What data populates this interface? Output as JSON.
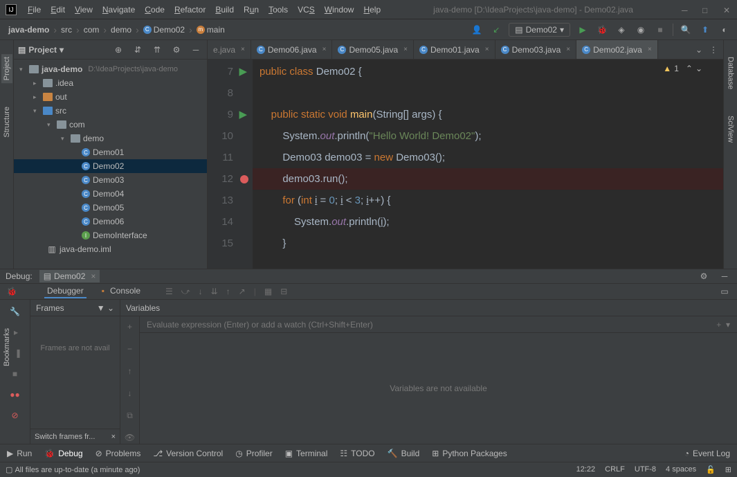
{
  "title": "java-demo [D:\\IdeaProjects\\java-demo] - Demo02.java",
  "menu": [
    "File",
    "Edit",
    "View",
    "Navigate",
    "Code",
    "Refactor",
    "Build",
    "Run",
    "Tools",
    "VCS",
    "Window",
    "Help"
  ],
  "breadcrumb": {
    "project": "java-demo",
    "parts": [
      "src",
      "com",
      "demo",
      "Demo02",
      "main"
    ]
  },
  "runConfig": "Demo02",
  "sideTabs": {
    "left": [
      "Project",
      "Structure",
      "Bookmarks"
    ],
    "right": [
      "Database",
      "SciView"
    ]
  },
  "projectPanel": {
    "title": "Project",
    "root": {
      "name": "java-demo",
      "path": "D:\\IdeaProjects\\java-demo"
    },
    "folders": {
      "idea": ".idea",
      "out": "out",
      "src": "src",
      "com": "com",
      "demo": "demo"
    },
    "classes": [
      "Demo01",
      "Demo02",
      "Demo03",
      "Demo04",
      "Demo05",
      "Demo06",
      "DemoInterface"
    ],
    "iml": "java-demo.iml"
  },
  "tabs": {
    "cut": "e.java",
    "items": [
      "Demo06.java",
      "Demo05.java",
      "Demo01.java",
      "Demo03.java",
      "Demo02.java"
    ],
    "active": "Demo02.java"
  },
  "code": {
    "lines": [
      {
        "n": 7,
        "run": true,
        "html": "<span class='kw'>public</span> <span class='kw'>class</span> <span class='txt'>Demo02 {</span>"
      },
      {
        "n": 8,
        "html": ""
      },
      {
        "n": 9,
        "run": true,
        "html": "    <span class='kw'>public</span> <span class='kw'>static</span> <span class='kw'>void</span> <span class='fn'>main</span><span class='txt'>(String[] args) {</span>"
      },
      {
        "n": 10,
        "html": "        <span class='txt'>System.</span><span class='fld'>out</span><span class='txt'>.println(</span><span class='str'>\"Hello World! Demo02\"</span><span class='txt'>);</span>"
      },
      {
        "n": 11,
        "html": "        <span class='txt'>Demo03 demo03 = </span><span class='kw'>new</span> <span class='txt'>Demo03();</span>"
      },
      {
        "n": 12,
        "bp": true,
        "html": "        <span class='txt'>demo03.run();</span>"
      },
      {
        "n": 13,
        "html": "        <span class='kw'>for</span> <span class='txt'>(</span><span class='kw'>int</span> <span class='txt'><u>i</u> = </span><span class='num'>0</span><span class='txt'>; <u>i</u> &lt; </span><span class='num'>3</span><span class='txt'>; <u>i</u>++) {</span>"
      },
      {
        "n": 14,
        "html": "            <span class='txt'>System.</span><span class='fld'>out</span><span class='txt'>.println(<u>i</u>);</span>"
      },
      {
        "n": 15,
        "html": "        <span class='txt'>}</span>"
      }
    ],
    "warnCount": "1"
  },
  "debug": {
    "label": "Debug:",
    "config": "Demo02",
    "subtabs": {
      "debugger": "Debugger",
      "console": "Console"
    },
    "frames": {
      "title": "Frames",
      "empty": "Frames are not avail",
      "footer": "Switch frames fr..."
    },
    "vars": {
      "title": "Variables",
      "placeholder": "Evaluate expression (Enter) or add a watch (Ctrl+Shift+Enter)",
      "empty": "Variables are not available"
    }
  },
  "bottomBar": {
    "run": "Run",
    "debug": "Debug",
    "problems": "Problems",
    "vcs": "Version Control",
    "profiler": "Profiler",
    "terminal": "Terminal",
    "todo": "TODO",
    "build": "Build",
    "python": "Python Packages",
    "eventlog": "Event Log"
  },
  "statusBar": {
    "msg": "All files are up-to-date (a minute ago)",
    "time": "12:22",
    "eol": "CRLF",
    "enc": "UTF-8",
    "indent": "4 spaces"
  }
}
